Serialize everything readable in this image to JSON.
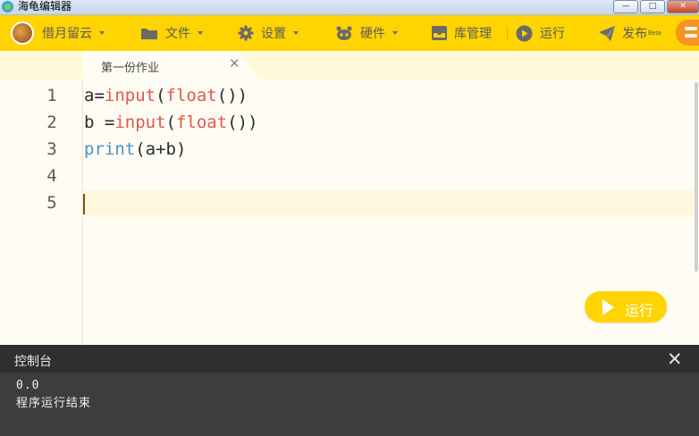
{
  "window": {
    "title": "海龟编辑器",
    "min_label": "—",
    "max_label": "□",
    "close_label": "✕"
  },
  "toolbar": {
    "user_label": "借月留云",
    "file_label": "文件",
    "settings_label": "设置",
    "hardware_label": "硬件",
    "library_label": "库管理",
    "run_label": "运行",
    "publish_label": "发布",
    "publish_badge": "Beta"
  },
  "tabs": [
    {
      "label": "第一份作业",
      "close": "✕"
    }
  ],
  "editor": {
    "line_numbers": [
      "1",
      "2",
      "3",
      "4",
      "5"
    ],
    "lines": [
      {
        "p1": "a=",
        "kw1": "input",
        "p2": "(",
        "kw2": "float",
        "p3": "())"
      },
      {
        "p1": "b =",
        "kw1": "input",
        "p2": "(",
        "kw2": "float",
        "p3": "())"
      },
      {
        "bi": "print",
        "p1": "(a+b)"
      }
    ]
  },
  "run_button": {
    "label": "运行"
  },
  "console": {
    "title": "控制台",
    "close": "✕",
    "output": [
      "0.0",
      "程序运行结束"
    ]
  },
  "colors": {
    "toolbar": "#ffd400",
    "editor_bg": "#fffdf3",
    "keyword": "#e0574d",
    "builtin": "#4b93c9",
    "console_bg": "#3d3d3d"
  }
}
